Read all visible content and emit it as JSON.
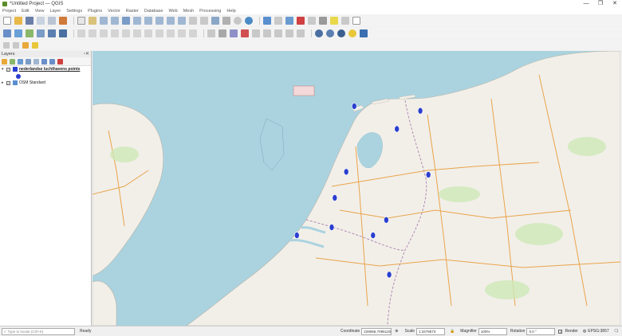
{
  "window": {
    "title": "*Untitled Project — QGIS",
    "controls": [
      "—",
      "❐",
      "✕"
    ]
  },
  "menu": [
    "Project",
    "Edit",
    "View",
    "Layer",
    "Settings",
    "Plugins",
    "Vector",
    "Raster",
    "Database",
    "Web",
    "Mesh",
    "Processing",
    "Help"
  ],
  "layers_panel": {
    "title": "Layers",
    "controls": "▫✕",
    "layers": [
      {
        "name": "nederlandse luchthavens points",
        "checked": true,
        "selected": true
      },
      {
        "name": "OSM Standard",
        "checked": true,
        "selected": false
      }
    ]
  },
  "map": {
    "marker_color": "#2a3fcf",
    "water_color": "#aad3df",
    "land_color": "#f2efe9",
    "markers": [
      {
        "lon": 4.76,
        "lat": 52.31
      },
      {
        "lon": 4.76,
        "lat": 52.31
      },
      {
        "lon": 4.49,
        "lat": 51.96
      },
      {
        "lon": 5.39,
        "lat": 51.45
      },
      {
        "lon": 6.5,
        "lat": 53.12
      },
      {
        "lon": 5.95,
        "lat": 52.88
      },
      {
        "lon": 4.42,
        "lat": 51.56
      },
      {
        "lon": 6.69,
        "lat": 52.27
      },
      {
        "lon": 5.77,
        "lat": 50.91
      },
      {
        "lon": 5.7,
        "lat": 51.66
      },
      {
        "lon": 3.6,
        "lat": 51.45
      },
      {
        "lon": 4.95,
        "lat": 53.18
      }
    ]
  },
  "status": {
    "search_placeholder": "Type to locate (Ctrl+K)",
    "ready": "Ready",
    "coordinate_label": "Coordinate",
    "coordinate_value": "229066,7095120",
    "scale_label": "Scale",
    "scale_value": "1:3479573",
    "magnifier_label": "Magnifier",
    "magnifier_value": "100%",
    "rotation_label": "Rotation",
    "rotation_value": "0.0 °",
    "render_label": "Render",
    "crs": "EPSG:3857"
  }
}
